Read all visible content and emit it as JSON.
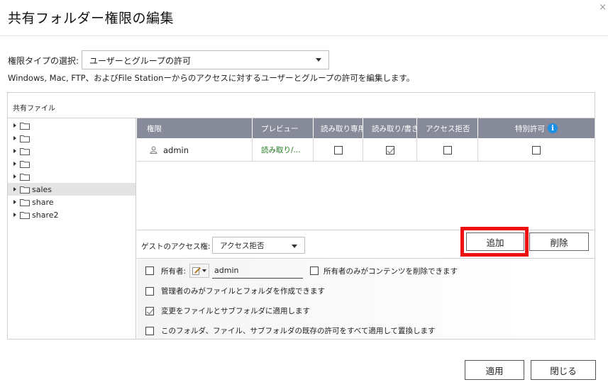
{
  "dialog": {
    "title": "共有フォルダー権限の編集",
    "close_glyph": "×"
  },
  "permission_type": {
    "label": "権限タイプの選択:",
    "selected": "ユーザーとグループの許可"
  },
  "description": "Windows, Mac, FTP、およびFile Stationーからのアクセスに対するユーザーとグループの許可を編集します。",
  "panel": {
    "header": "共有ファイル"
  },
  "tree": {
    "items": [
      {
        "label": "",
        "selected": false
      },
      {
        "label": "",
        "selected": false
      },
      {
        "label": "",
        "selected": false
      },
      {
        "label": "",
        "selected": false
      },
      {
        "label": "",
        "selected": false
      },
      {
        "label": "sales",
        "selected": true
      },
      {
        "label": "share",
        "selected": false
      },
      {
        "label": "share2",
        "selected": false
      }
    ]
  },
  "grid": {
    "columns": [
      "権限",
      "プレビュー",
      "読み取り専用",
      "読み取り/書き込み",
      "アクセス拒否",
      "特別許可"
    ],
    "rows": [
      {
        "user": "admin",
        "preview": "読み取り/...",
        "read_only": false,
        "read_write": true,
        "deny": false,
        "special": false
      }
    ]
  },
  "guest": {
    "label": "ゲストのアクセス権:",
    "selected": "アクセス拒否"
  },
  "buttons": {
    "add": "追加",
    "delete": "削除",
    "apply": "適用",
    "close": "閉じる"
  },
  "options": {
    "owner_label": "所有者:",
    "owner_value": "admin",
    "owner_only_delete": "所有者のみがコンテンツを削除できます",
    "admin_only_create": "管理者のみがファイルとフォルダを作成できます",
    "apply_to_subfolders": "変更をファイルとサブフォルダに適用します",
    "replace_existing": "このフォルダ、ファイル、サブフォルダの既存の許可をすべて適用して置換します"
  },
  "states": {
    "owner_checked": false,
    "owner_only_delete_checked": false,
    "admin_only_create_checked": false,
    "apply_to_subfolders_checked": true,
    "replace_existing_checked": false
  },
  "colors": {
    "grid_header": "#878b99",
    "highlight": "#ee1010",
    "info": "#1a8fe3",
    "preview_text": "#1e7a1e"
  },
  "icons": {
    "close": "close-icon",
    "caret": "chevron-down-icon",
    "folder": "folder-icon",
    "tree_arrow": "triangle-right-icon",
    "user": "user-icon",
    "info": "info-icon",
    "pencil": "pencil-icon"
  }
}
